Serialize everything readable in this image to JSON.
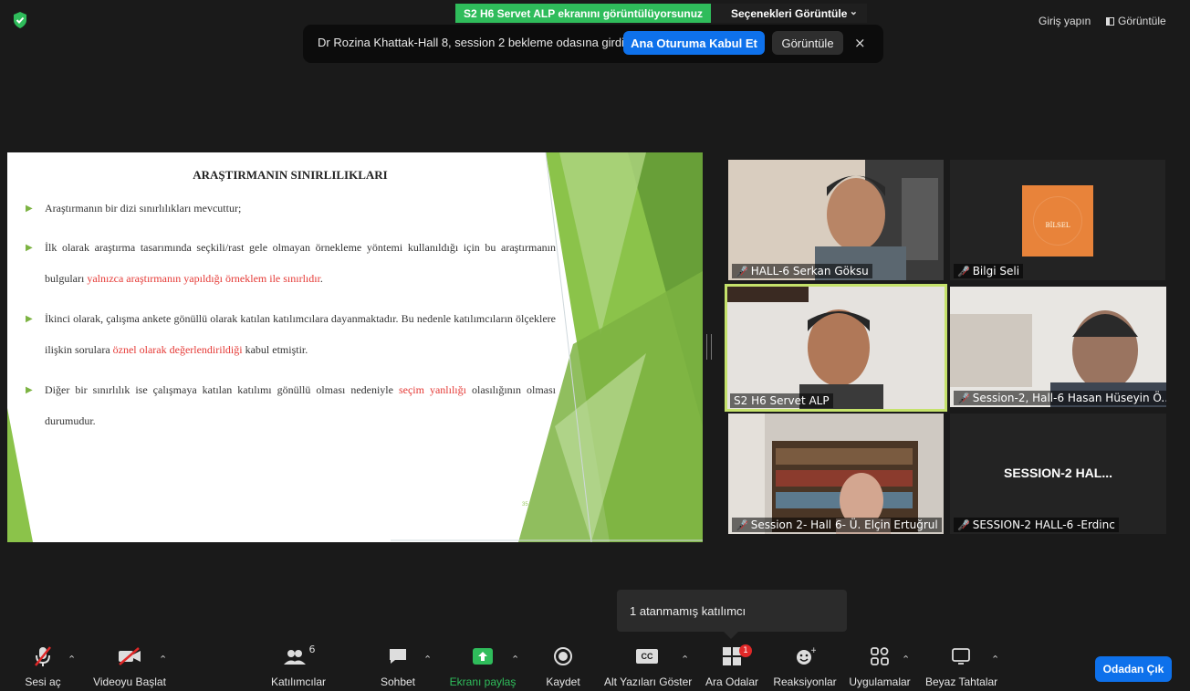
{
  "topbar": {
    "share_banner": "S2 H6 Servet ALP ekranını görüntülüyorsunuz",
    "view_options": "Seçenekleri Görüntüle",
    "sign_in": "Giriş yapın",
    "view_menu": "Görüntüle"
  },
  "waiting_room": {
    "message": "Dr Rozina Khattak-Hall 8, session 2 bekleme odasına girdi",
    "admit_label": "Ana Oturuma Kabul Et",
    "view_label": "Görüntüle",
    "close_label": "×"
  },
  "slide": {
    "title": "ARAŞTIRMANIN SINIRLILIKLARI",
    "b1": "Araştırmanın bir dizi sınırlılıkları mevcuttur;",
    "b2_part1": "İlk olarak araştırma tasarımında seçkili/rast gele olmayan örnekleme yöntemi kullanıldığı için bu araştırmanın bulguları ",
    "b2_red": "yalnızca araştırmanın yapıldığı örneklem ile sınırlıdır",
    "b2_end": ".",
    "b3_part1": "İkinci olarak, çalışma ankete gönüllü olarak katılan katılımcılara dayanmaktadır. Bu nedenle katılımcıların ölçeklere ilişkin sorulara ",
    "b3_red": "öznel olarak değerlendirildiği",
    "b3_end": " kabul etmiştir.",
    "b4_part1": "Diğer bir sınırlılık ise çalışmaya katılan katılımı gönüllü olması nedeniyle ",
    "b4_red": "seçim yanlılığı",
    "b4_end": " olasılığının olması durumudur.",
    "page_number": "35"
  },
  "participants": [
    {
      "name": "HALL-6 Serkan Göksu",
      "muted": true
    },
    {
      "name": "Bilgi Seli",
      "muted": true
    },
    {
      "name": "S2 H6 Servet ALP",
      "muted": false
    },
    {
      "name": "Session-2, Hall-6 Hasan Hüseyin Ö...",
      "muted": true
    },
    {
      "name": "Session 2- Hall 6- Ü. Elçin Ertuğrul",
      "muted": true
    },
    {
      "name": "SESSION-2  HALL-6 -Erdinc",
      "muted": true
    }
  ],
  "logo_text": "BİLSEL",
  "tile6_big_text": "SESSION-2   HAL...",
  "tooltip": "1 atanmamış katılımcı",
  "toolbar": {
    "audio": "Sesi aç",
    "video": "Videoyu Başlat",
    "participants": "Katılımcılar",
    "participants_count": "6",
    "chat": "Sohbet",
    "share": "Ekranı paylaş",
    "record": "Kaydet",
    "captions": "Alt Yazıları Göster",
    "breakout": "Ara Odalar",
    "breakout_badge": "1",
    "reactions": "Reaksiyonlar",
    "apps": "Uygulamalar",
    "whiteboard": "Beyaz Tahtalar",
    "leave": "Odadan Çık"
  },
  "colors": {
    "share_green": "#2fbc5b",
    "accent_blue": "#0e71eb",
    "muted_red": "#e02828",
    "active_speaker": "#c5e26b",
    "slide_green": "#7cb342"
  }
}
